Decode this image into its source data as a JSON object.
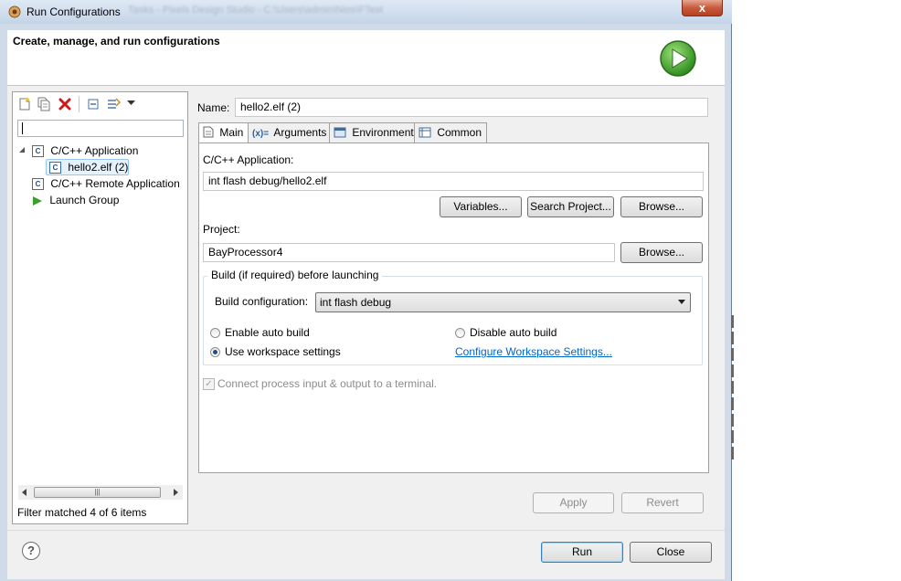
{
  "window": {
    "title": "Run Configurations",
    "blurred_title": "Tasks - Pixels Design Studio - C:\\Users\\admin\\Nios\\FTest",
    "close_symbol": "x"
  },
  "header": {
    "title": "Create, manage, and run configurations"
  },
  "left": {
    "toolbar_icons": [
      "new-config-icon",
      "duplicate-icon",
      "delete-icon",
      "collapse-all-icon",
      "filter-icon",
      "dropdown-arrow-icon"
    ],
    "filter_value": "",
    "tree": [
      {
        "label": "C/C++ Application",
        "level": 0,
        "expanded": true,
        "icon": "c-app-icon"
      },
      {
        "label": "hello2.elf (2)",
        "level": 1,
        "selected": true,
        "icon": "c-app-icon"
      },
      {
        "label": "C/C++ Remote Application",
        "level": 0,
        "icon": "c-app-icon"
      },
      {
        "label": "Launch Group",
        "level": 0,
        "icon": "launch-group-icon"
      }
    ],
    "status": "Filter matched 4 of 6 items"
  },
  "config": {
    "name_label": "Name:",
    "name_value": "hello2.elf (2)",
    "tabs": [
      {
        "label": "Main",
        "active": true,
        "icon": "main-tab-icon"
      },
      {
        "label": "Arguments",
        "icon": "arguments-tab-icon"
      },
      {
        "label": "Environment",
        "icon": "environment-tab-icon"
      },
      {
        "label": "Common",
        "icon": "common-tab-icon"
      }
    ],
    "app_label": "C/C++ Application:",
    "app_value": "int flash debug/hello2.elf",
    "variables_btn": "Variables...",
    "search_btn": "Search Project...",
    "browse_btn": "Browse...",
    "project_label": "Project:",
    "project_value": "BayProcessor4",
    "project_browse_btn": "Browse...",
    "build_group_label": "Build (if required) before launching",
    "build_config_label": "Build configuration:",
    "build_config_value": "int flash debug",
    "enable_auto_build": "Enable auto build",
    "disable_auto_build": "Disable auto build",
    "use_workspace": "Use workspace settings",
    "configure_link": "Configure Workspace Settings...",
    "connect_terminal": "Connect process input & output to a terminal.",
    "selected_build_option": "use_workspace"
  },
  "buttons": {
    "apply": "Apply",
    "revert": "Revert",
    "run": "Run",
    "close": "Close",
    "help": "?"
  }
}
